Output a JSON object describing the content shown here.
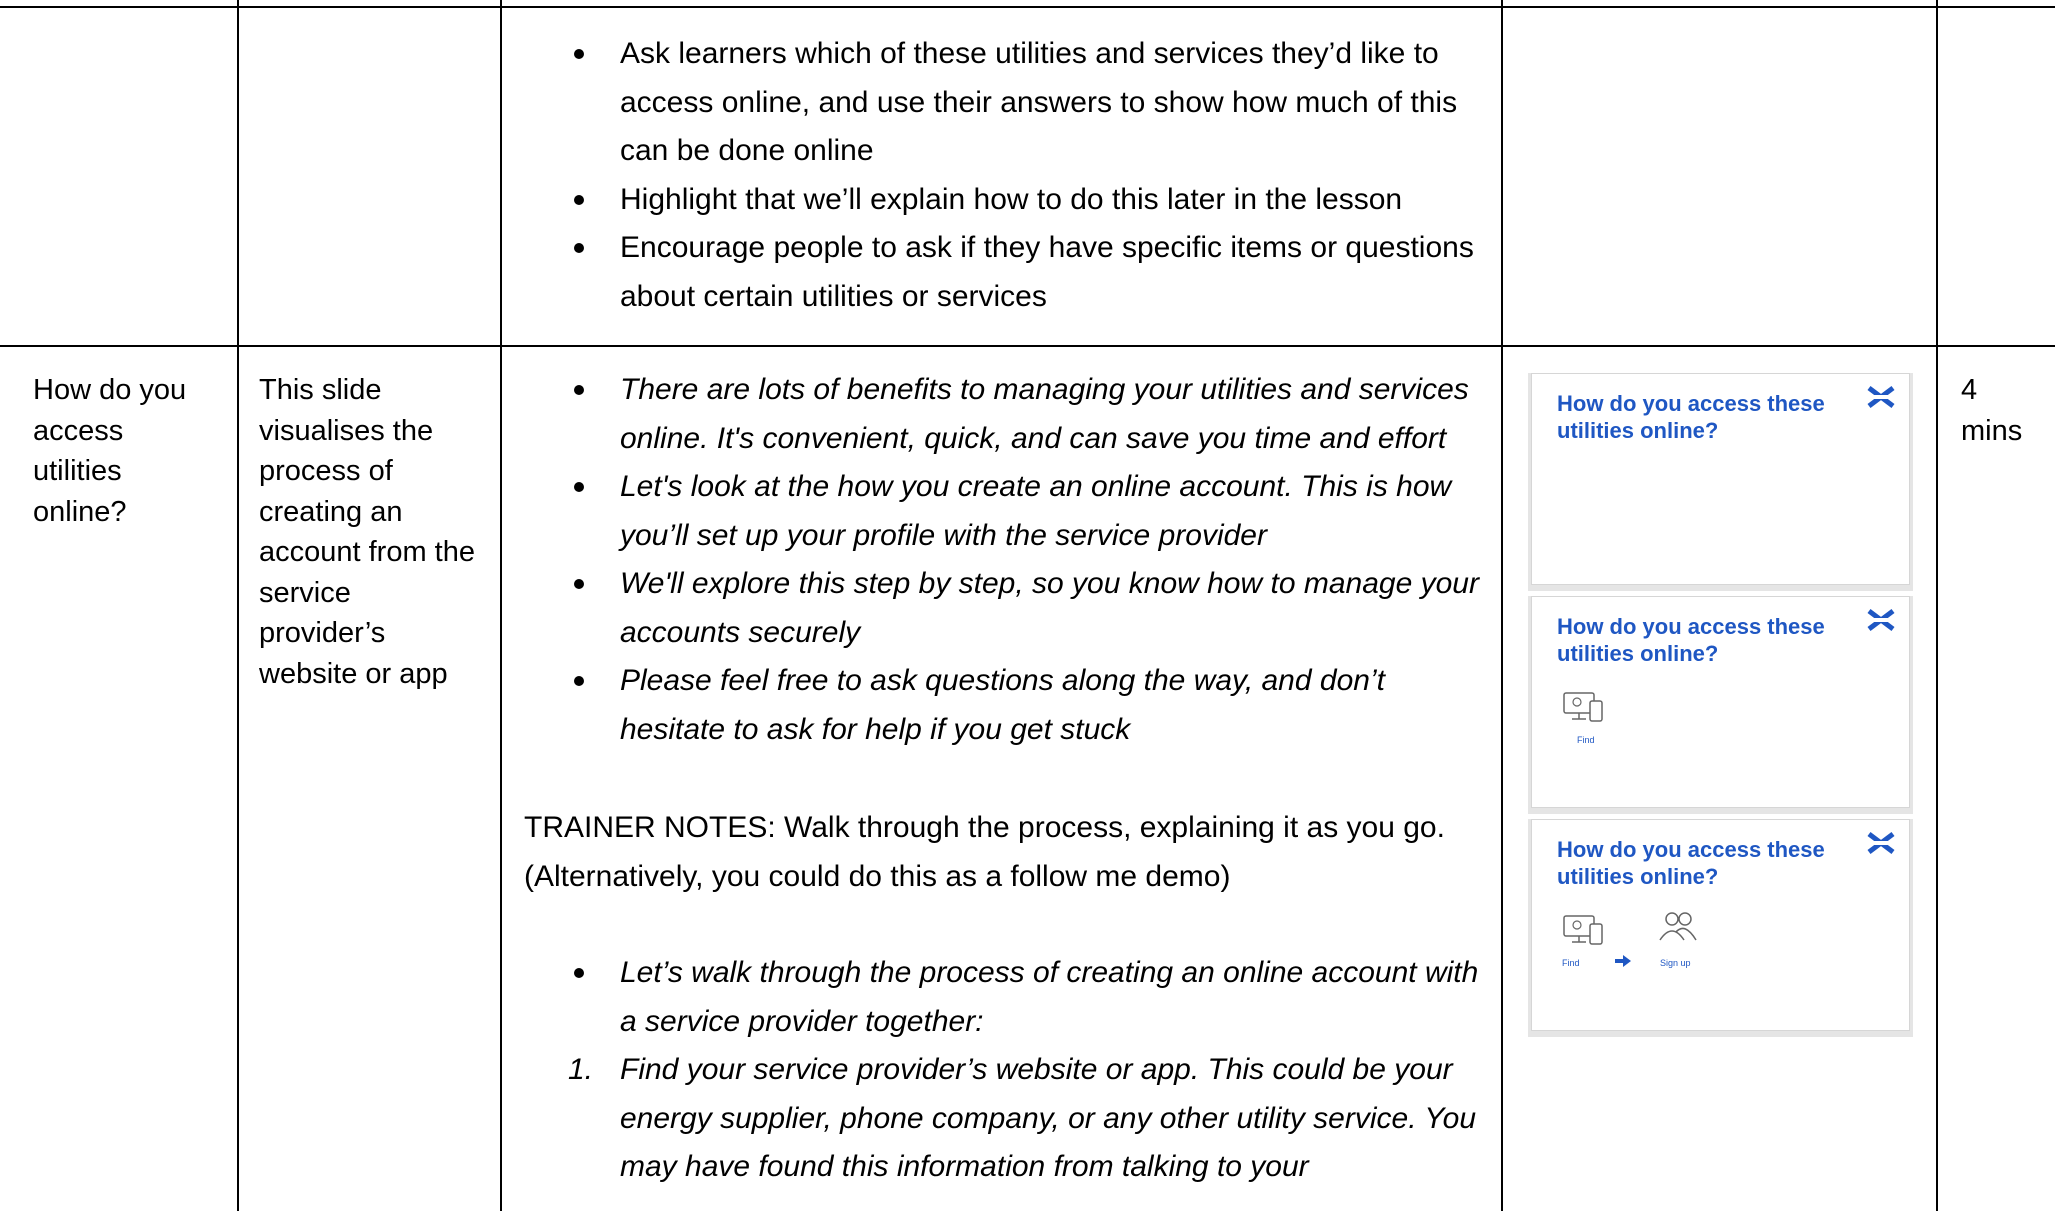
{
  "row1": {
    "bullets": [
      "Ask learners which of these utilities and services they’d like to access online, and use their answers to show how much of this can be done online",
      "Highlight that we’ll explain how to do this later in the lesson",
      "Encourage people to ask if they have specific items or questions about certain utilities or services"
    ]
  },
  "row2": {
    "topic": "How do you access utilities online?",
    "description": "This slide visualises the process of creating an account from the service provider’s website or app",
    "script_bullets": [
      "There are lots of benefits to managing your utilities and services online. It's convenient, quick, and can save you time and effort",
      "Let's look at the how you create an online account. This is how you’ll set up your profile with the service provider",
      "We'll explore this step by step, so you know how to manage your accounts securely",
      "Please feel free to ask questions along the way, and don’t hesitate to ask for help if you get stuck"
    ],
    "trainer_notes": "TRAINER NOTES: Walk through the process, explaining it as you go. (Alternatively, you could do this as a follow me demo)",
    "walkthrough_bullet": "Let’s walk through the process of creating an online account with a service provider together:",
    "step_number": "1.",
    "step_1": "Find your service provider’s website or app. This could be your energy supplier, phone company, or any other utility service. You may have found this information from talking to your",
    "duration": "4 mins",
    "slides": [
      {
        "title": "How do you access these utilities online?",
        "logo": "HALIFAX",
        "captions": []
      },
      {
        "title": "How do you access these utilities online?",
        "logo": "HALIFAX",
        "captions": [
          "Find"
        ]
      },
      {
        "title": "How do you access these utilities online?",
        "logo": "HALIFAX",
        "captions": [
          "Find",
          "Sign up"
        ]
      }
    ]
  },
  "colors": {
    "slide_title": "#1f57c3",
    "border": "#000000"
  },
  "icons": [
    "computer-search-icon",
    "people-icon",
    "arrow-right-icon",
    "halifax-logo"
  ]
}
